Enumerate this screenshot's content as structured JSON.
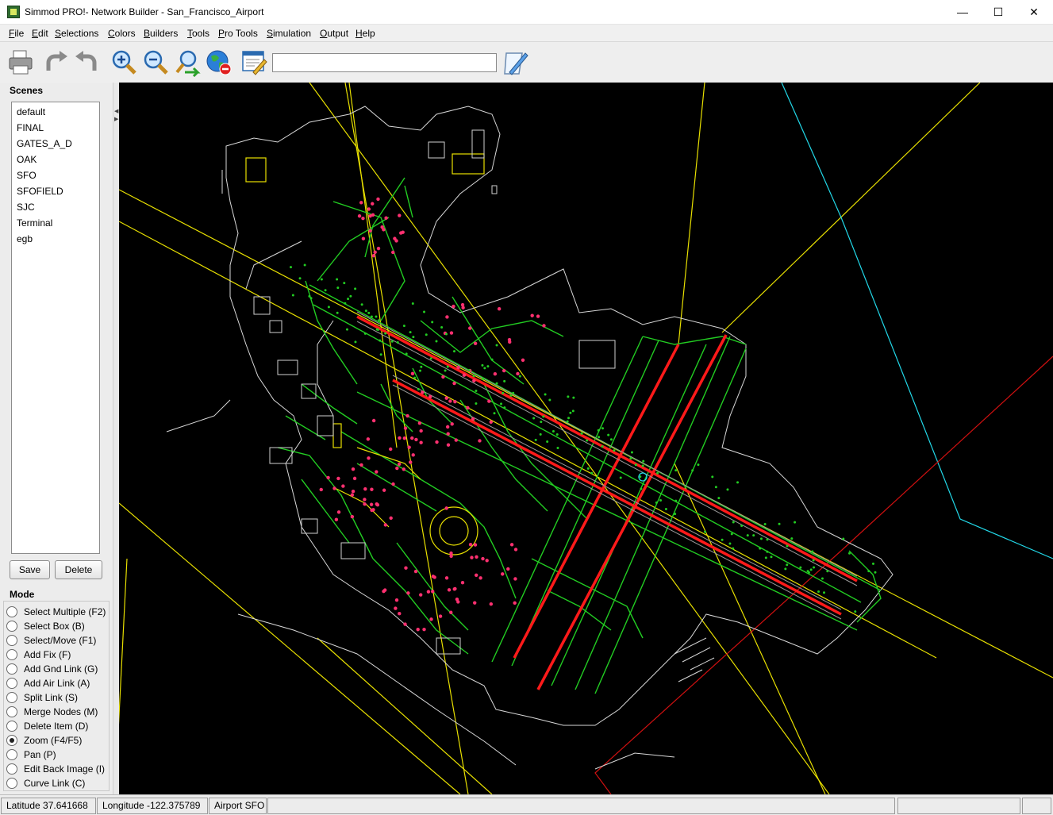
{
  "window": {
    "title": "Simmod PRO!- Network Builder - San_Francisco_Airport",
    "minimize": "—",
    "maximize": "☐",
    "close": "✕"
  },
  "menu": [
    "File",
    "Edit",
    "Selections",
    "Colors",
    "Builders",
    "Tools",
    "Pro Tools",
    "Simulation",
    "Output",
    "Help"
  ],
  "toolbar": {
    "icons": [
      "printer-icon",
      "redo-icon",
      "undo-icon",
      "zoom-in-icon",
      "zoom-out-icon",
      "zoom-back-icon",
      "globe-delete-icon",
      "window-edit-icon",
      "notepad-edit-icon"
    ],
    "search_value": ""
  },
  "scenes": {
    "label": "Scenes",
    "items": [
      "default",
      "FINAL",
      "GATES_A_D",
      "OAK",
      "SFO",
      "SFOFIELD",
      "SJC",
      "Terminal",
      "egb"
    ],
    "save_label": "Save",
    "delete_label": "Delete"
  },
  "mode": {
    "label": "Mode",
    "options": [
      {
        "label": "Select Multiple (F2)",
        "checked": false
      },
      {
        "label": "Select Box (B)",
        "checked": false
      },
      {
        "label": "Select/Move (F1)",
        "checked": false
      },
      {
        "label": "Add Fix (F)",
        "checked": false
      },
      {
        "label": "Add Gnd Link (G)",
        "checked": false
      },
      {
        "label": "Add Air Link (A)",
        "checked": false
      },
      {
        "label": "Split Link (S)",
        "checked": false
      },
      {
        "label": "Merge Nodes (M)",
        "checked": false
      },
      {
        "label": "Delete Item (D)",
        "checked": false
      },
      {
        "label": "Zoom (F4/F5)",
        "checked": true
      },
      {
        "label": "Pan (P)",
        "checked": false
      },
      {
        "label": "Edit Back Image (I)",
        "checked": false
      },
      {
        "label": "Curve Link (C)",
        "checked": false
      }
    ]
  },
  "status": {
    "latitude": "Latitude  37.641668",
    "longitude": "Longitude  -122.375789",
    "airport": "Airport SFO"
  },
  "colors": {
    "canvas": "#000000",
    "taxiway": "#22cc22",
    "runway": "#ff1a1a",
    "gate": "#ff3070",
    "air_route": "#e8e000",
    "boundary": "#e0e0e0",
    "cyan_route": "#22d8e8",
    "red_route": "#d01010"
  }
}
